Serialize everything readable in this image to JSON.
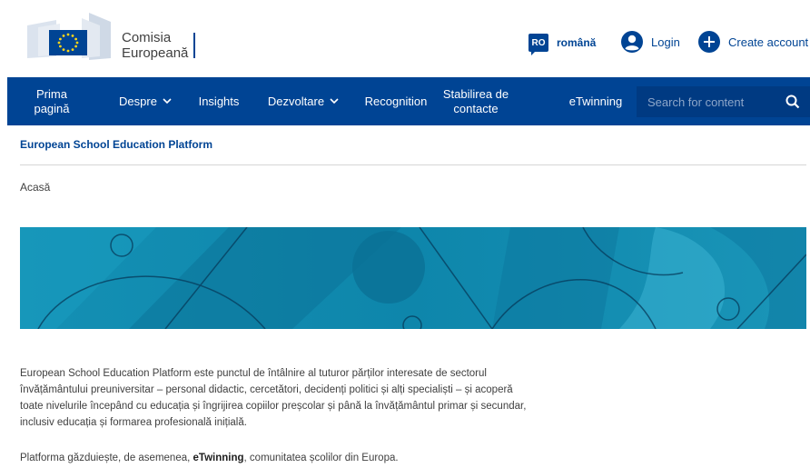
{
  "header": {
    "logo_line1": "Comisia",
    "logo_line2": "Europeană",
    "lang_code": "RO",
    "lang_name": "română",
    "login_label": "Login",
    "create_account_label": "Create account"
  },
  "nav": {
    "items": [
      {
        "label": "Prima pagină"
      },
      {
        "label": "Despre",
        "has_dropdown": true
      },
      {
        "label": "Insights"
      },
      {
        "label": "Dezvoltare",
        "has_dropdown": true
      },
      {
        "label": "Recognition"
      },
      {
        "label": "Stabilirea de contacte"
      },
      {
        "label": "eTwinning"
      }
    ],
    "search_placeholder": "Search for content"
  },
  "site_title": "European School Education Platform",
  "breadcrumb": "Acasă",
  "intro": {
    "paragraph1": "European School Education Platform este punctul de întâlnire al tuturor părților interesate de sectorul învățământului preuniversitar – personal didactic, cercetători, decidenți politici și alți specialiști – și acoperă toate nivelurile începând cu educația și îngrijirea copiilor preșcolar și până la învățământul primar și secundar, inclusiv educația și formarea profesională inițială.",
    "paragraph2_before": "Platforma găzduiește, de asemenea, ",
    "paragraph2_bold": "eTwinning",
    "paragraph2_after": ", comunitatea școlilor din Europa."
  },
  "colors": {
    "ec_blue": "#004494",
    "banner_teal": "#0e7fa3",
    "eu_yellow": "#ffd617"
  },
  "icons": [
    "eu-flag-logo",
    "user-icon",
    "plus-circle-icon",
    "chevron-down-icon",
    "search-icon"
  ]
}
